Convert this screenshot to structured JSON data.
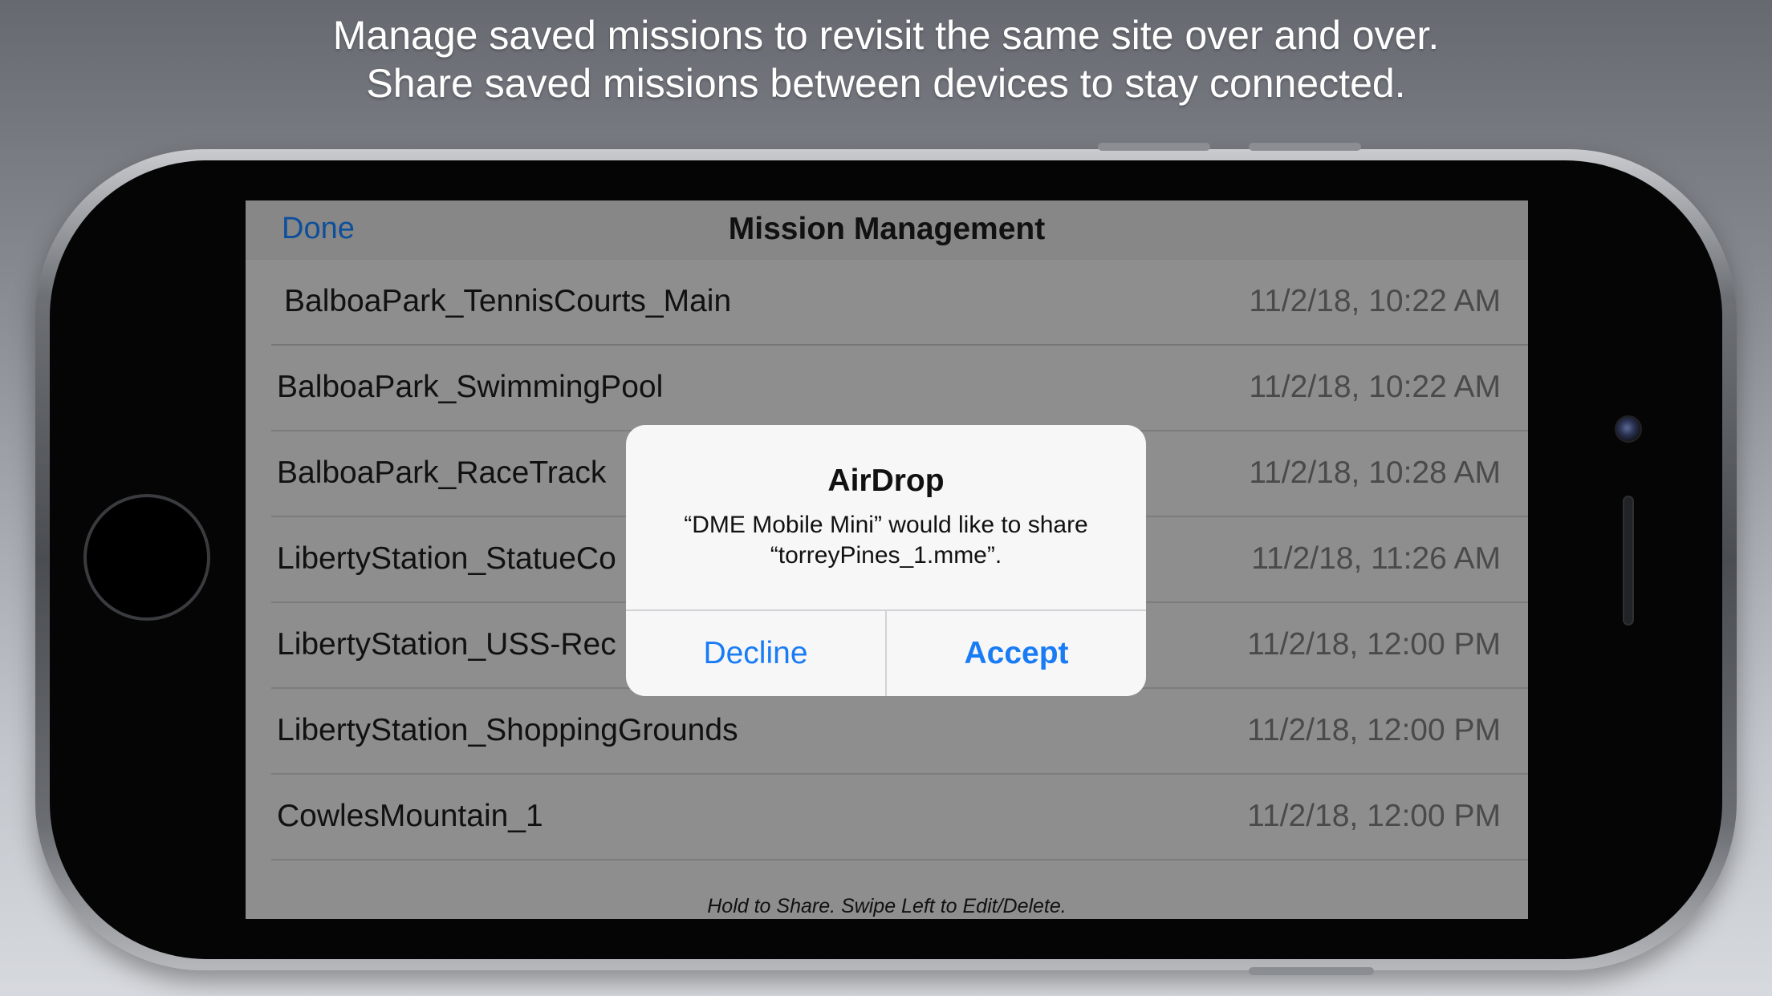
{
  "caption": {
    "line1": "Manage saved missions to revisit the same site over and over.",
    "line2": "Share saved missions between devices to stay connected."
  },
  "navbar": {
    "done_label": "Done",
    "title": "Mission Management"
  },
  "missions": [
    {
      "name": "BalboaPark_TennisCourts_Main",
      "date": "11/2/18, 10:22 AM"
    },
    {
      "name": "BalboaPark_SwimmingPool",
      "date": "11/2/18, 10:22 AM"
    },
    {
      "name": "BalboaPark_RaceTrack",
      "date": "11/2/18, 10:28 AM"
    },
    {
      "name": "LibertyStation_StatueCo",
      "date": "11/2/18, 11:26 AM"
    },
    {
      "name": "LibertyStation_USS-Rec",
      "date": "11/2/18, 12:00 PM"
    },
    {
      "name": "LibertyStation_ShoppingGrounds",
      "date": "11/2/18, 12:00 PM"
    },
    {
      "name": "CowlesMountain_1",
      "date": "11/2/18, 12:00 PM"
    }
  ],
  "footer": {
    "hint": "Hold to Share. Swipe Left to Edit/Delete."
  },
  "alert": {
    "title": "AirDrop",
    "message_line1": "“DME Mobile Mini” would like to share",
    "message_line2": "“torreyPines_1.mme”.",
    "decline_label": "Decline",
    "accept_label": "Accept"
  },
  "colors": {
    "accent": "#1a7cf5",
    "nav_done": "#0e4f9c",
    "screen_dimmed": "#8e8e8e"
  }
}
